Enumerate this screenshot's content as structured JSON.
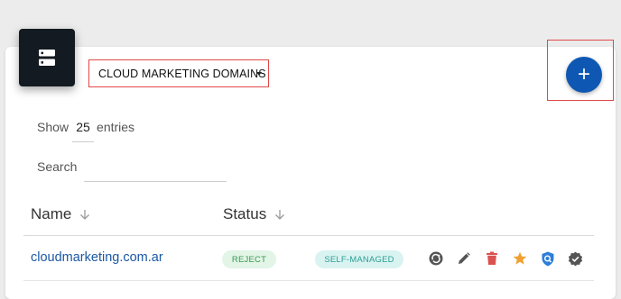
{
  "domain_selector": {
    "label": "CLOUD MARKETING DOMAINS"
  },
  "add_button": {
    "label": "+"
  },
  "table_controls": {
    "show_label": "Show",
    "page_size": "25",
    "entries_label": "entries",
    "search_label": "Search",
    "search_value": ""
  },
  "table": {
    "columns": [
      {
        "label": "Name",
        "sort_icon": "arrow-down-icon"
      },
      {
        "label": "Status",
        "sort_icon": "arrow-down-icon"
      }
    ],
    "rows": [
      {
        "name": "cloudmarketing.com.ar",
        "status": "REJECT",
        "management": "SELF-MANAGED",
        "actions": [
          "refresh-icon",
          "edit-icon",
          "delete-icon",
          "star-icon",
          "shield-search-icon",
          "verified-badge-icon"
        ]
      }
    ]
  },
  "colors": {
    "accent": "#0e58b3",
    "link": "#1b58a5",
    "highlight_border": "#e04848",
    "reject_bg": "#e2f5e7",
    "reject_text": "#3a9a50",
    "managed_bg": "#d9f3f1",
    "managed_text": "#2c9e94",
    "delete_icon": "#d9534f",
    "star_icon": "#f0a030",
    "shield_icon": "#2d7fd8",
    "neutral_icon": "#555555"
  }
}
